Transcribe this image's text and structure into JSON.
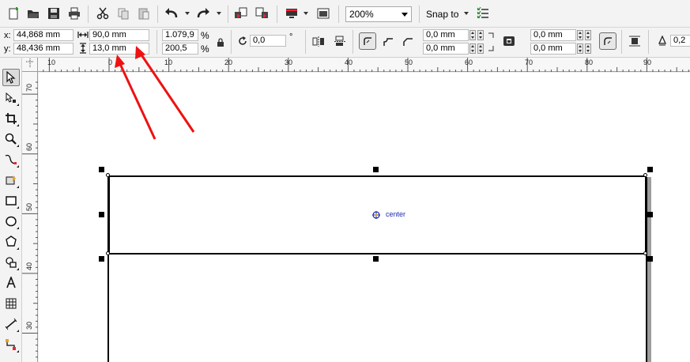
{
  "toolbar": {
    "zoom_value": "200%",
    "snap_label": "Snap to"
  },
  "properties": {
    "x_label": "x:",
    "x_value": "44,868 mm",
    "y_label": "y:",
    "y_value": "48,436 mm",
    "width_value": "90,0 mm",
    "height_value": "13,0 mm",
    "scale_x": "1.079,9",
    "scale_y": "200,5",
    "percent": "%",
    "rotation_value": "0,0",
    "degree": "°",
    "corner_tl": "0,0 mm",
    "corner_bl": "0,0 mm",
    "corner_tr": "0,0 mm",
    "corner_br": "0,0 mm",
    "outline_width": "0,2"
  },
  "ruler": {
    "top_numbers": [
      "10",
      "0",
      "10",
      "20",
      "30",
      "40",
      "50",
      "60",
      "70",
      "80",
      "90"
    ],
    "left_numbers": [
      "70",
      "60",
      "50",
      "40",
      "30"
    ]
  },
  "canvas": {
    "center_label": "center"
  },
  "colors": {
    "annotation_arrow": "#ee1111",
    "center_label": "#1a2bb0"
  }
}
